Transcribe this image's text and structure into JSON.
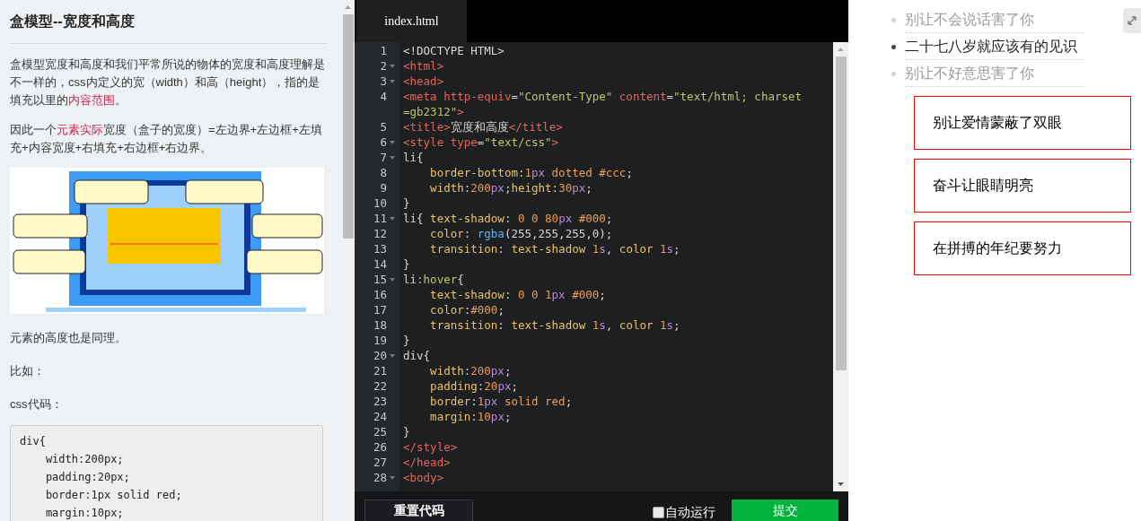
{
  "article": {
    "title": "盒模型--宽度和高度",
    "paragraphs": [
      [
        {
          "text": "盒模型宽度和高度和我们平常所说的物体的宽度和高度理解是不一样的，css内定义的宽（width）和高（height），指的是填充以里的",
          "highlight": false
        },
        {
          "text": "内容范围",
          "highlight": true
        },
        {
          "text": "。",
          "highlight": false
        }
      ],
      [
        {
          "text": "因此一个",
          "highlight": false
        },
        {
          "text": "元素实际",
          "highlight": true
        },
        {
          "text": "宽度（盒子的宽度）=左边界+左边框+左填充+内容宽度+右填充+右边框+右边界。",
          "highlight": false
        }
      ]
    ],
    "after": [
      "元素的高度也是同理。",
      "比如：",
      "css代码："
    ],
    "code_lines": [
      "div{",
      "    width:200px;",
      "    padding:20px;",
      "    border:1px solid red;",
      "    margin:10px;"
    ]
  },
  "editor": {
    "tab": {
      "label": "index.html",
      "selected": true
    },
    "lines": [
      {
        "num": "1",
        "fold": false,
        "tokens": [
          {
            "text": "<!DOCTYPE HTML>",
            "kind": "plain"
          }
        ]
      },
      {
        "num": "2",
        "fold": true,
        "tokens": [
          {
            "text": "<html>",
            "kind": "tag"
          }
        ]
      },
      {
        "num": "3",
        "fold": true,
        "tokens": [
          {
            "text": "<head>",
            "kind": "tag"
          }
        ]
      },
      {
        "num": "4",
        "fold": false,
        "tokens": [
          {
            "text": "<meta ",
            "kind": "tag"
          },
          {
            "text": "http-equiv",
            "kind": "attr"
          },
          {
            "text": "=",
            "kind": "plain"
          },
          {
            "text": "\"Content-Type\"",
            "kind": "str"
          },
          {
            "text": " content",
            "kind": "attr"
          },
          {
            "text": "=",
            "kind": "plain"
          },
          {
            "text": "\"text/html; charset",
            "kind": "str"
          }
        ]
      },
      {
        "fold": false,
        "tokens": [
          {
            "text": "=gb2312\"",
            "kind": "str"
          },
          {
            "text": ">",
            "kind": "tag"
          }
        ]
      },
      {
        "num": "5",
        "fold": false,
        "tokens": [
          {
            "text": "<title>",
            "kind": "tag"
          },
          {
            "text": "宽度和高度",
            "kind": "plain"
          },
          {
            "text": "</title>",
            "kind": "tag"
          }
        ]
      },
      {
        "num": "6",
        "fold": true,
        "tokens": [
          {
            "text": "<style ",
            "kind": "tag"
          },
          {
            "text": "type",
            "kind": "attr"
          },
          {
            "text": "=",
            "kind": "plain"
          },
          {
            "text": "\"text/css\"",
            "kind": "str"
          },
          {
            "text": ">",
            "kind": "tag"
          }
        ]
      },
      {
        "num": "7",
        "fold": true,
        "tokens": [
          {
            "text": "li{",
            "kind": "plain"
          }
        ]
      },
      {
        "num": "8",
        "fold": false,
        "tokens": [
          {
            "text": "    border-bottom",
            "kind": "prop"
          },
          {
            "text": ":",
            "kind": "plain"
          },
          {
            "text": "1",
            "kind": "num"
          },
          {
            "text": "px",
            "kind": "unit"
          },
          {
            "text": " dotted #ccc",
            "kind": "val"
          },
          {
            "text": ";",
            "kind": "plain"
          }
        ]
      },
      {
        "num": "9",
        "fold": false,
        "tokens": [
          {
            "text": "    width",
            "kind": "prop"
          },
          {
            "text": ":",
            "kind": "plain"
          },
          {
            "text": "200",
            "kind": "num"
          },
          {
            "text": "px",
            "kind": "unit"
          },
          {
            "text": ";",
            "kind": "plain"
          },
          {
            "text": "height",
            "kind": "prop"
          },
          {
            "text": ":",
            "kind": "plain"
          },
          {
            "text": "30",
            "kind": "num"
          },
          {
            "text": "px",
            "kind": "unit"
          },
          {
            "text": ";",
            "kind": "plain"
          }
        ]
      },
      {
        "num": "10",
        "fold": false,
        "tokens": [
          {
            "text": "}",
            "kind": "plain"
          }
        ]
      },
      {
        "num": "11",
        "fold": true,
        "tokens": [
          {
            "text": "li{ ",
            "kind": "plain"
          },
          {
            "text": "text-shadow",
            "kind": "prop"
          },
          {
            "text": ": ",
            "kind": "plain"
          },
          {
            "text": "0 0 80",
            "kind": "num"
          },
          {
            "text": "px",
            "kind": "unit"
          },
          {
            "text": " #000",
            "kind": "val"
          },
          {
            "text": ";",
            "kind": "plain"
          }
        ]
      },
      {
        "num": "12",
        "fold": false,
        "tokens": [
          {
            "text": "    color",
            "kind": "prop"
          },
          {
            "text": ": ",
            "kind": "plain"
          },
          {
            "text": "rgba",
            "kind": "fn"
          },
          {
            "text": "(255,255,255,0);",
            "kind": "plain"
          }
        ]
      },
      {
        "num": "13",
        "fold": false,
        "tokens": [
          {
            "text": "    transition",
            "kind": "prop"
          },
          {
            "text": ": ",
            "kind": "plain"
          },
          {
            "text": "text-shadow ",
            "kind": "prop"
          },
          {
            "text": "1",
            "kind": "num"
          },
          {
            "text": "s",
            "kind": "unit"
          },
          {
            "text": ", ",
            "kind": "plain"
          },
          {
            "text": "color ",
            "kind": "prop"
          },
          {
            "text": "1",
            "kind": "num"
          },
          {
            "text": "s",
            "kind": "unit"
          },
          {
            "text": ";",
            "kind": "plain"
          }
        ]
      },
      {
        "num": "14",
        "fold": false,
        "tokens": [
          {
            "text": "}",
            "kind": "plain"
          }
        ]
      },
      {
        "num": "15",
        "fold": true,
        "tokens": [
          {
            "text": "li",
            "kind": "plain"
          },
          {
            "text": ":hover",
            "kind": "pseudo"
          },
          {
            "text": "{",
            "kind": "plain"
          }
        ]
      },
      {
        "num": "16",
        "fold": false,
        "tokens": [
          {
            "text": "    text-shadow",
            "kind": "prop"
          },
          {
            "text": ": ",
            "kind": "plain"
          },
          {
            "text": "0 0 1",
            "kind": "num"
          },
          {
            "text": "px",
            "kind": "unit"
          },
          {
            "text": " #000",
            "kind": "val"
          },
          {
            "text": ";",
            "kind": "plain"
          }
        ]
      },
      {
        "num": "17",
        "fold": false,
        "tokens": [
          {
            "text": "    color",
            "kind": "prop"
          },
          {
            "text": ":",
            "kind": "plain"
          },
          {
            "text": "#000",
            "kind": "val"
          },
          {
            "text": ";",
            "kind": "plain"
          }
        ]
      },
      {
        "num": "18",
        "fold": false,
        "tokens": [
          {
            "text": "    transition",
            "kind": "prop"
          },
          {
            "text": ": ",
            "kind": "plain"
          },
          {
            "text": "text-shadow ",
            "kind": "prop"
          },
          {
            "text": "1",
            "kind": "num"
          },
          {
            "text": "s",
            "kind": "unit"
          },
          {
            "text": ", ",
            "kind": "plain"
          },
          {
            "text": "color ",
            "kind": "prop"
          },
          {
            "text": "1",
            "kind": "num"
          },
          {
            "text": "s",
            "kind": "unit"
          },
          {
            "text": ";",
            "kind": "plain"
          }
        ]
      },
      {
        "num": "19",
        "fold": false,
        "tokens": [
          {
            "text": "}",
            "kind": "plain"
          }
        ]
      },
      {
        "num": "20",
        "fold": true,
        "tokens": [
          {
            "text": "div{",
            "kind": "plain"
          }
        ]
      },
      {
        "num": "21",
        "fold": false,
        "tokens": [
          {
            "text": "    width",
            "kind": "prop"
          },
          {
            "text": ":",
            "kind": "plain"
          },
          {
            "text": "200",
            "kind": "num"
          },
          {
            "text": "px",
            "kind": "unit"
          },
          {
            "text": ";",
            "kind": "plain"
          }
        ]
      },
      {
        "num": "22",
        "fold": false,
        "tokens": [
          {
            "text": "    padding",
            "kind": "prop"
          },
          {
            "text": ":",
            "kind": "plain"
          },
          {
            "text": "20",
            "kind": "num"
          },
          {
            "text": "px",
            "kind": "unit"
          },
          {
            "text": ";",
            "kind": "plain"
          }
        ]
      },
      {
        "num": "23",
        "fold": false,
        "tokens": [
          {
            "text": "    border",
            "kind": "prop"
          },
          {
            "text": ":",
            "kind": "plain"
          },
          {
            "text": "1",
            "kind": "num"
          },
          {
            "text": "px",
            "kind": "unit"
          },
          {
            "text": " solid red",
            "kind": "val"
          },
          {
            "text": ";",
            "kind": "plain"
          }
        ]
      },
      {
        "num": "24",
        "fold": false,
        "tokens": [
          {
            "text": "    margin",
            "kind": "prop"
          },
          {
            "text": ":",
            "kind": "plain"
          },
          {
            "text": "10",
            "kind": "num"
          },
          {
            "text": "px",
            "kind": "unit"
          },
          {
            "text": ";",
            "kind": "plain"
          }
        ]
      },
      {
        "num": "25",
        "fold": false,
        "tokens": [
          {
            "text": "}",
            "kind": "plain"
          }
        ]
      },
      {
        "num": "26",
        "fold": false,
        "tokens": [
          {
            "text": "</style>",
            "kind": "tag"
          }
        ]
      },
      {
        "num": "27",
        "fold": false,
        "tokens": [
          {
            "text": "</head>",
            "kind": "tag"
          }
        ]
      },
      {
        "num": "28",
        "fold": true,
        "tokens": [
          {
            "text": "<body>",
            "kind": "tag"
          }
        ]
      }
    ],
    "reset_button": "重置代码",
    "autorun": {
      "label": "自动运行",
      "checked": false
    },
    "submit_button": "提交"
  },
  "preview": {
    "list": [
      {
        "text": "别让不会说话害了你",
        "hovered": false
      },
      {
        "text": "二十七八岁就应该有的见识",
        "hovered": true
      },
      {
        "text": "别让不好意思害了你",
        "hovered": false
      }
    ],
    "boxes": [
      "别让爱情蒙蔽了双眼",
      "奋斗让眼睛明亮",
      "在拼搏的年纪要努力"
    ]
  }
}
